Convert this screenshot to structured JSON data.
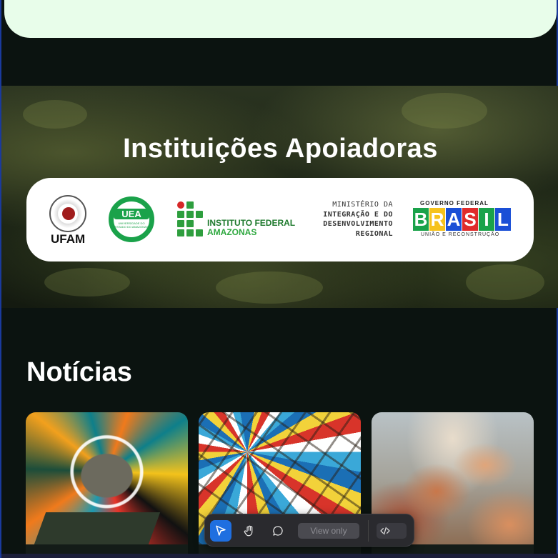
{
  "supporters": {
    "title": "Instituições Apoiadoras",
    "ufam": "UFAM",
    "uea": "UEA",
    "uea_sub": "UNIVERSIDADE DO ESTADO DO AMAZONAS",
    "ifam_line1": "INSTITUTO FEDERAL",
    "ifam_line2": "AMAZONAS",
    "ministerio_line1": "MINISTÉRIO DA",
    "ministerio_line2": "INTEGRAÇÃO E DO",
    "ministerio_line3": "DESENVOLVIMENTO",
    "ministerio_line4": "REGIONAL",
    "gov_top": "GOVERNO FEDERAL",
    "gov_letters": [
      "B",
      "R",
      "A",
      "S",
      "I",
      "L"
    ],
    "gov_letter_colors": [
      "#1aa24a",
      "#f6c21c",
      "#1a4fd6",
      "#e02b2b",
      "#1aa24a",
      "#1a4fd6"
    ],
    "gov_bottom": "UNIÃO E RECONSTRUÇÃO"
  },
  "news": {
    "title": "Notícias"
  },
  "toolbar": {
    "view_label": "View only",
    "select_tool_icon": "cursor-arrow-icon",
    "hand_tool_icon": "hand-icon",
    "comment_tool_icon": "comment-bubble-icon",
    "code_icon": "code-brackets-icon"
  },
  "colors": {
    "accent": "#1f6fe0",
    "top_card": "#e8fdea",
    "background": "#0b1310"
  }
}
